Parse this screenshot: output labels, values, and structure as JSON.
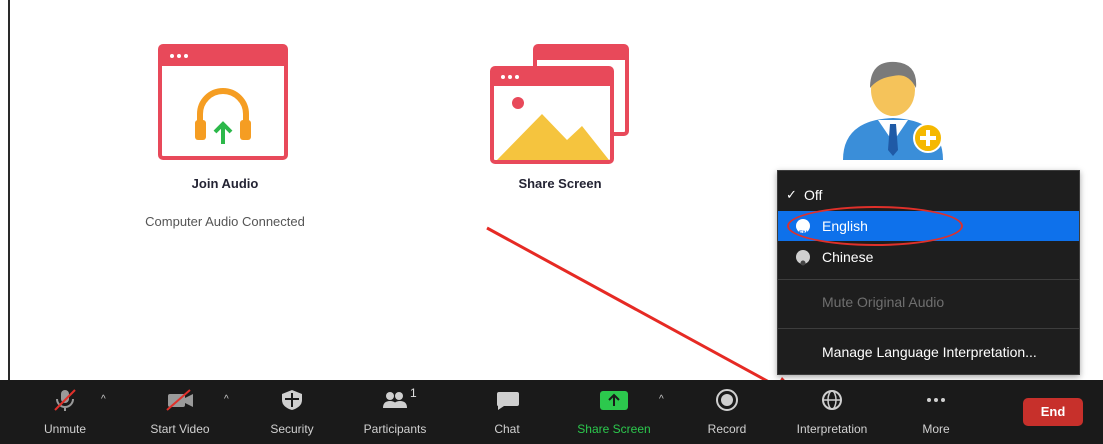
{
  "tiles": {
    "join_audio": {
      "label": "Join Audio",
      "sub": "Computer Audio Connected"
    },
    "share_screen": {
      "label": "Share Screen"
    }
  },
  "menu": {
    "items": [
      {
        "label": "Off",
        "checked": true
      },
      {
        "label": "English",
        "selected": true,
        "flag_color": "#ffffff"
      },
      {
        "label": "Chinese",
        "flag_color": "#cfcfcf"
      },
      {
        "label": "Mute Original Audio",
        "disabled": true
      },
      {
        "label": "Manage Language Interpretation..."
      }
    ],
    "check_mark": "✓"
  },
  "toolbar": {
    "unmute": "Unmute",
    "start_video": "Start Video",
    "security": "Security",
    "participants": "Participants",
    "participants_count": "1",
    "chat": "Chat",
    "share_screen": "Share Screen",
    "record": "Record",
    "interpretation": "Interpretation",
    "more": "More",
    "end": "End",
    "share_color": "#2cc84d"
  },
  "colors": {
    "accent_red": "#e0302a",
    "selected_blue": "#0e71eb",
    "end_red": "#c7302b"
  }
}
